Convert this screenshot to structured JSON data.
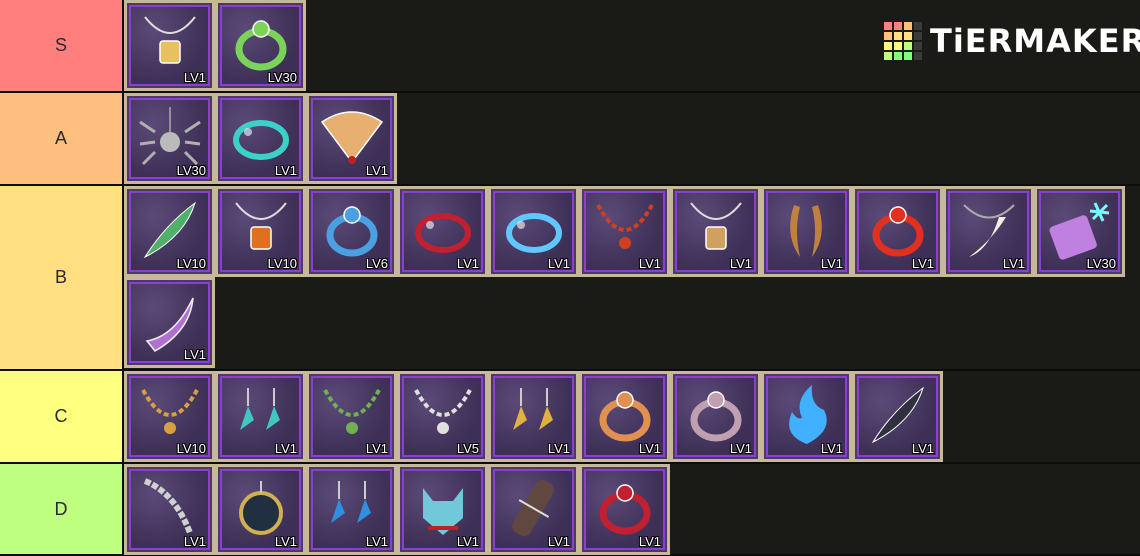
{
  "branding": {
    "logo_text": "TiERMAKER",
    "logo_colors": [
      "#ff7f7f",
      "#ffbf7f",
      "#ffdf7f",
      "#ffff7f",
      "#bfff7f",
      "#7fff7f",
      "#3a3a3a"
    ]
  },
  "tiers": [
    {
      "label": "S",
      "color": "#ff7f7f",
      "items": [
        {
          "name": "amulet-pendant",
          "level": "LV1",
          "icon": "pendant-icon",
          "accent": "#e8c060"
        },
        {
          "name": "green-serpent-ring",
          "level": "LV30",
          "icon": "ring-icon",
          "accent": "#7bd35a"
        }
      ]
    },
    {
      "label": "A",
      "color": "#ffbf7f",
      "items": [
        {
          "name": "spider-necklace",
          "level": "LV30",
          "icon": "spider-icon",
          "accent": "#b0b0b0"
        },
        {
          "name": "teal-bracelet",
          "level": "LV1",
          "icon": "bracelet-icon",
          "accent": "#3cd0c8"
        },
        {
          "name": "paper-fan",
          "level": "LV1",
          "icon": "fan-icon",
          "accent": "#e8b070"
        }
      ]
    },
    {
      "label": "B",
      "color": "#ffdf7f",
      "items": [
        {
          "name": "peacock-feather",
          "level": "LV10",
          "icon": "feather-icon",
          "accent": "#4fb06a"
        },
        {
          "name": "amber-necklace",
          "level": "LV10",
          "icon": "pendant-icon",
          "accent": "#e07020"
        },
        {
          "name": "sapphire-ring",
          "level": "LV6",
          "icon": "ring-icon",
          "accent": "#4aa0e0"
        },
        {
          "name": "red-cord-bracelet",
          "level": "LV1",
          "icon": "bracelet-icon",
          "accent": "#c02030"
        },
        {
          "name": "crystal-bangle",
          "level": "LV1",
          "icon": "bracelet-icon",
          "accent": "#60c8ff"
        },
        {
          "name": "bead-necklace",
          "level": "LV1",
          "icon": "necklace-icon",
          "accent": "#d04020"
        },
        {
          "name": "charm-necklace",
          "level": "LV1",
          "icon": "pendant-icon",
          "accent": "#d0a060"
        },
        {
          "name": "horn-pair",
          "level": "LV1",
          "icon": "horn-icon",
          "accent": "#c08040"
        },
        {
          "name": "red-jewel-ring",
          "level": "LV1",
          "icon": "ring-icon",
          "accent": "#e03020"
        },
        {
          "name": "fang-necklace",
          "level": "LV1",
          "icon": "fang-icon",
          "accent": "#f0f0e0"
        },
        {
          "name": "frost-comb",
          "level": "LV30",
          "icon": "comb-icon",
          "accent": "#c080e0"
        },
        {
          "name": "violet-claw",
          "level": "LV1",
          "icon": "claw-icon",
          "accent": "#b070d0"
        }
      ]
    },
    {
      "label": "C",
      "color": "#ffff7f",
      "items": [
        {
          "name": "bone-necklace",
          "level": "LV10",
          "icon": "necklace-icon",
          "accent": "#d8a040"
        },
        {
          "name": "leaf-earrings",
          "level": "LV1",
          "icon": "earring-icon",
          "accent": "#40c8c0"
        },
        {
          "name": "dreamcatcher-necklace",
          "level": "LV1",
          "icon": "necklace-icon",
          "accent": "#70b050"
        },
        {
          "name": "pearl-cord",
          "level": "LV5",
          "icon": "necklace-icon",
          "accent": "#e0e0e0"
        },
        {
          "name": "gold-hoops",
          "level": "LV1",
          "icon": "earring-icon",
          "accent": "#e0b040"
        },
        {
          "name": "gold-band",
          "level": "LV1",
          "icon": "ring-icon",
          "accent": "#e09050"
        },
        {
          "name": "silver-band",
          "level": "LV1",
          "icon": "ring-icon",
          "accent": "#c0a0b0"
        },
        {
          "name": "blue-flame",
          "level": "LV1",
          "icon": "flame-icon",
          "accent": "#40b0ff"
        },
        {
          "name": "dark-feather",
          "level": "LV1",
          "icon": "feather-icon",
          "accent": "#303040"
        }
      ]
    },
    {
      "label": "D",
      "color": "#bfff7f",
      "items": [
        {
          "name": "bone-whip",
          "level": "LV1",
          "icon": "bone-icon",
          "accent": "#d0d0d0"
        },
        {
          "name": "dark-medallion",
          "level": "LV1",
          "icon": "medallion-icon",
          "accent": "#d0b050"
        },
        {
          "name": "blue-bead-earrings",
          "level": "LV1",
          "icon": "earring-icon",
          "accent": "#3090e0"
        },
        {
          "name": "wolf-mask",
          "level": "LV1",
          "icon": "wolf-icon",
          "accent": "#70c8d8"
        },
        {
          "name": "wrapped-scroll",
          "level": "LV1",
          "icon": "scroll-icon",
          "accent": "#604840"
        },
        {
          "name": "ruby-signet-ring",
          "level": "LV1",
          "icon": "ring-icon",
          "accent": "#c02030"
        }
      ]
    }
  ]
}
